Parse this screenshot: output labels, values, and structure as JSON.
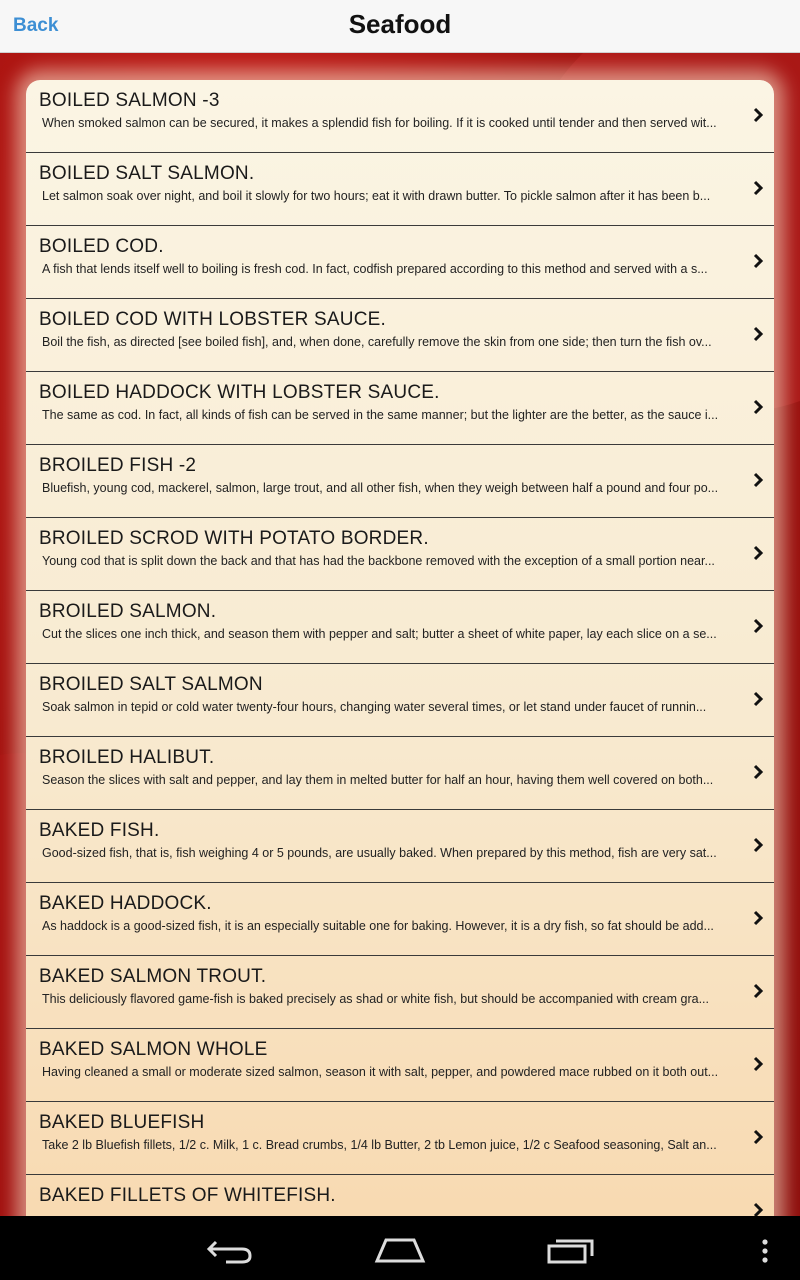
{
  "header": {
    "back_label": "Back",
    "title": "Seafood"
  },
  "recipes": [
    {
      "title": "BOILED SALMON -3",
      "desc": "When smoked salmon can be secured, it makes a splendid fish for boiling. If it is cooked until tender and then served wit..."
    },
    {
      "title": "BOILED SALT SALMON.",
      "desc": "Let salmon soak over night, and boil it slowly for two hours; eat it with drawn butter. To pickle salmon after it has been b..."
    },
    {
      "title": "BOILED COD.",
      "desc": "A fish that lends itself well to boiling is fresh cod. In fact, codfish prepared according to this method and served with a s..."
    },
    {
      "title": "BOILED COD WITH LOBSTER SAUCE.",
      "desc": "Boil the fish, as directed [see boiled fish], and, when done, carefully remove the skin from one side; then turn the fish ov..."
    },
    {
      "title": "BOILED HADDOCK WITH LOBSTER SAUCE.",
      "desc": "The same as cod. In fact, all kinds of fish can be served in the same manner; but the lighter are the better, as the sauce i..."
    },
    {
      "title": "BROILED FISH -2",
      "desc": "Bluefish, young cod, mackerel, salmon, large trout, and all other fish, when they weigh between half a pound and four po..."
    },
    {
      "title": "BROILED SCROD WITH POTATO BORDER.",
      "desc": "Young cod that is split down the back and that has had the backbone removed with the exception of a small portion near..."
    },
    {
      "title": "BROILED SALMON.",
      "desc": "Cut the slices one inch thick, and season them with pepper and salt; butter a sheet of white paper, lay each slice on a se..."
    },
    {
      "title": "BROILED SALT SALMON",
      "desc": "Soak salmon in tepid or cold water twenty-four hours, changing water several times, or let stand under faucet of runnin..."
    },
    {
      "title": "BROILED HALIBUT.",
      "desc": "Season the slices with salt and pepper, and lay them in melted butter for half an hour, having them well covered on both..."
    },
    {
      "title": "BAKED FISH.",
      "desc": "Good-sized fish, that is, fish weighing 4 or 5 pounds, are usually baked. When prepared by this method, fish are very sat..."
    },
    {
      "title": "BAKED HADDOCK.",
      "desc": "As haddock is a good-sized fish, it is an especially suitable one for baking. However, it is a dry fish, so fat should be add..."
    },
    {
      "title": "BAKED SALMON TROUT.",
      "desc": "This deliciously flavored game-fish is baked precisely as shad or white fish, but should be accompanied with cream gra..."
    },
    {
      "title": "BAKED SALMON WHOLE",
      "desc": "Having cleaned a small or moderate sized salmon, season it with salt, pepper, and powdered mace rubbed on it both out..."
    },
    {
      "title": "BAKED BLUEFISH",
      "desc": "Take 2 lb Bluefish fillets, 1/2 c. Milk, 1 c. Bread crumbs, 1/4 lb Butter, 2 tb Lemon juice, 1/2 c Seafood seasoning, Salt an..."
    },
    {
      "title": "BAKED FILLETS OF WHITEFISH.",
      "desc": ""
    }
  ],
  "icons": {
    "row_chevron": "chevron-right-icon",
    "nav_back": "nav-back-icon",
    "nav_home": "nav-home-icon",
    "nav_recents": "nav-recents-icon",
    "nav_menu": "overflow-menu-icon"
  },
  "colors": {
    "accent_link": "#3d8fd4",
    "background_red": "#a5120f",
    "panel": "#fbf5e4"
  }
}
